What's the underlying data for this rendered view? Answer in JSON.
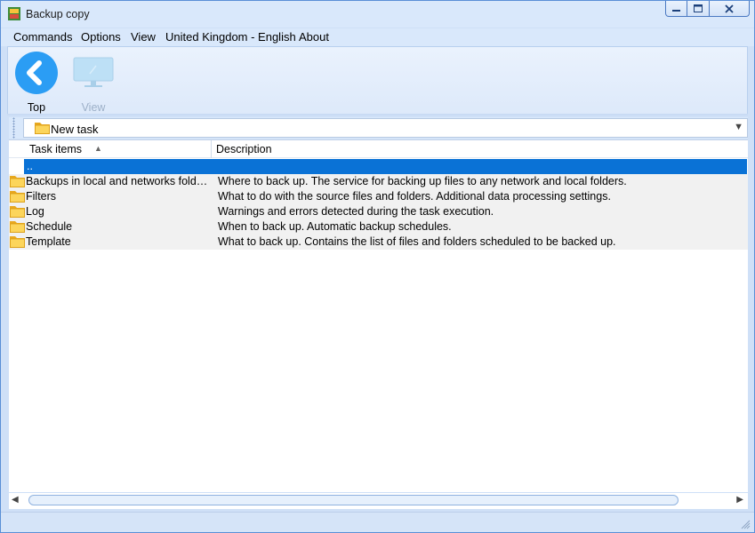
{
  "window": {
    "title": "Backup copy"
  },
  "menu": {
    "items": [
      "Commands",
      "Options",
      "View",
      "United Kingdom - English",
      "About"
    ]
  },
  "toolbar": {
    "top_label": "Top",
    "view_label": "View"
  },
  "address": {
    "value": "New task"
  },
  "table": {
    "columns": [
      "Task items",
      "Description"
    ],
    "sort_column": "Task items",
    "sort_direction": "ascending",
    "rows": [
      {
        "name": "..",
        "description": "",
        "selected": true
      },
      {
        "name": "Backups in local and networks folders",
        "description": "Where to back up. The service for backing up files to any network and local folders."
      },
      {
        "name": "Filters",
        "description": "What to do with the source files and folders. Additional data processing settings."
      },
      {
        "name": "Log",
        "description": "Warnings and errors detected during the task execution."
      },
      {
        "name": "Schedule",
        "description": "When to back up. Automatic backup schedules."
      },
      {
        "name": "Template",
        "description": "What to back up. Contains the list of files and folders scheduled to be backed up."
      }
    ]
  },
  "colors": {
    "accent": "#0a72d6",
    "window_frame": "#d9e8fb",
    "back_button": "#2b9df4"
  },
  "icons": [
    "app-icon",
    "back-arrow-icon",
    "monitor-icon",
    "folder-icon",
    "dropdown-arrow-icon",
    "sort-ascending-icon",
    "scroll-left-icon",
    "scroll-right-icon",
    "size-grip-icon"
  ]
}
